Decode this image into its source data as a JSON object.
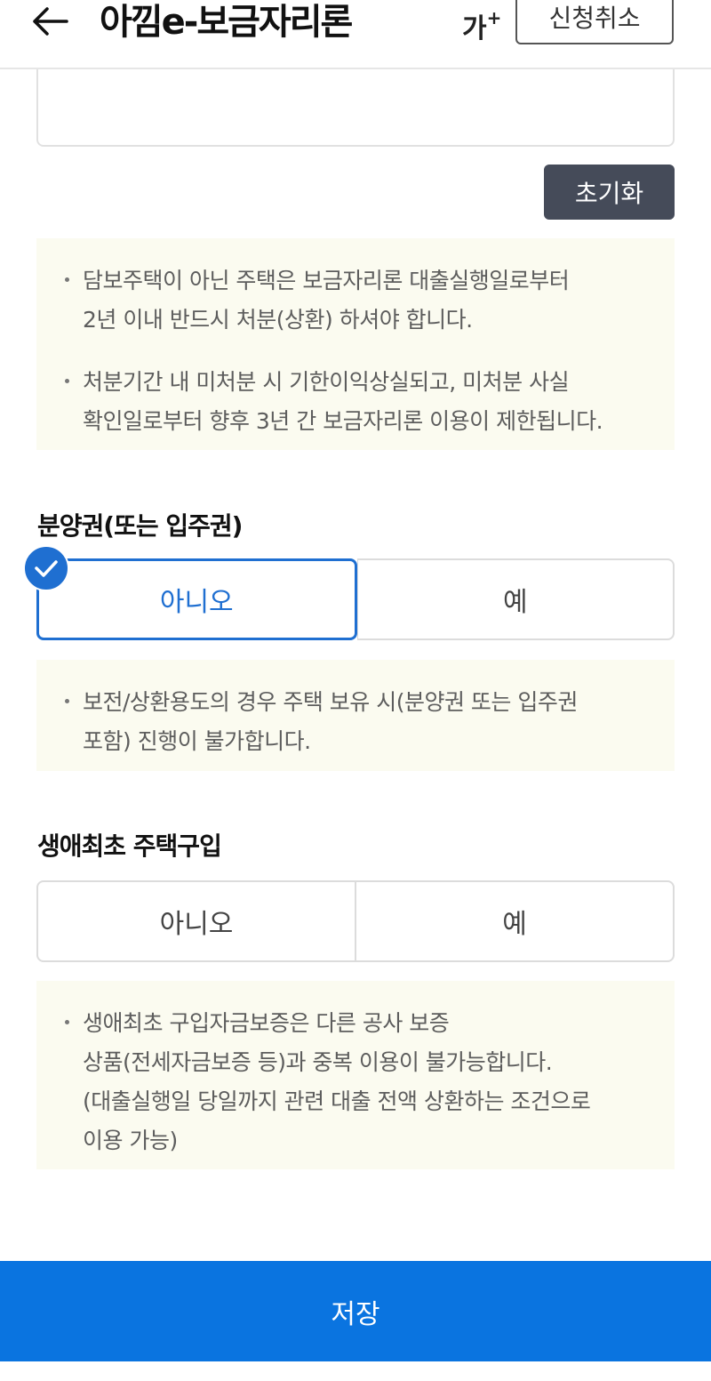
{
  "header": {
    "title": "아낌e-보금자리론",
    "font_size_label": "가",
    "font_size_plus": "+",
    "cancel_label": "신청취소"
  },
  "reset_label": "초기화",
  "notice1": {
    "item1_line1": "담보주택이 아닌 주택은 보금자리론 대출실행일로부터",
    "item1_line2": "2년 이내 반드시 처분(상환) 하셔야 합니다.",
    "item2_line1": "처분기간 내 미처분 시 기한이익상실되고, 미처분 사실",
    "item2_line2": "확인일로부터 향후 3년 간 보금자리론 이용이 제한됩니다."
  },
  "presale": {
    "title": "분양권(또는 입주권)",
    "option_no": "아니오",
    "option_yes": "예",
    "selected": "아니오"
  },
  "notice2": {
    "item1_line1": "보전/상환용도의 경우 주택 보유 시(분양권 또는 입주권",
    "item1_line2": "포함) 진행이 불가합니다."
  },
  "first_home": {
    "title": "생애최초 주택구입",
    "option_no": "아니오",
    "option_yes": "예"
  },
  "notice3": {
    "line1": "생애최초 구입자금보증은 다른 공사 보증",
    "line2": "상품(전세자금보증 등)과 중복 이용이 불가능합니다.",
    "line3": "(대출실행일 당일까지 관련 대출 전액 상환하는 조건으로",
    "line4": "이용 가능)"
  },
  "save_label": "저장",
  "colors": {
    "accent": "#1f6fd1",
    "save_bar": "#0a74e0",
    "reset_button": "#454b59",
    "notice_bg": "#fbfbf0"
  }
}
